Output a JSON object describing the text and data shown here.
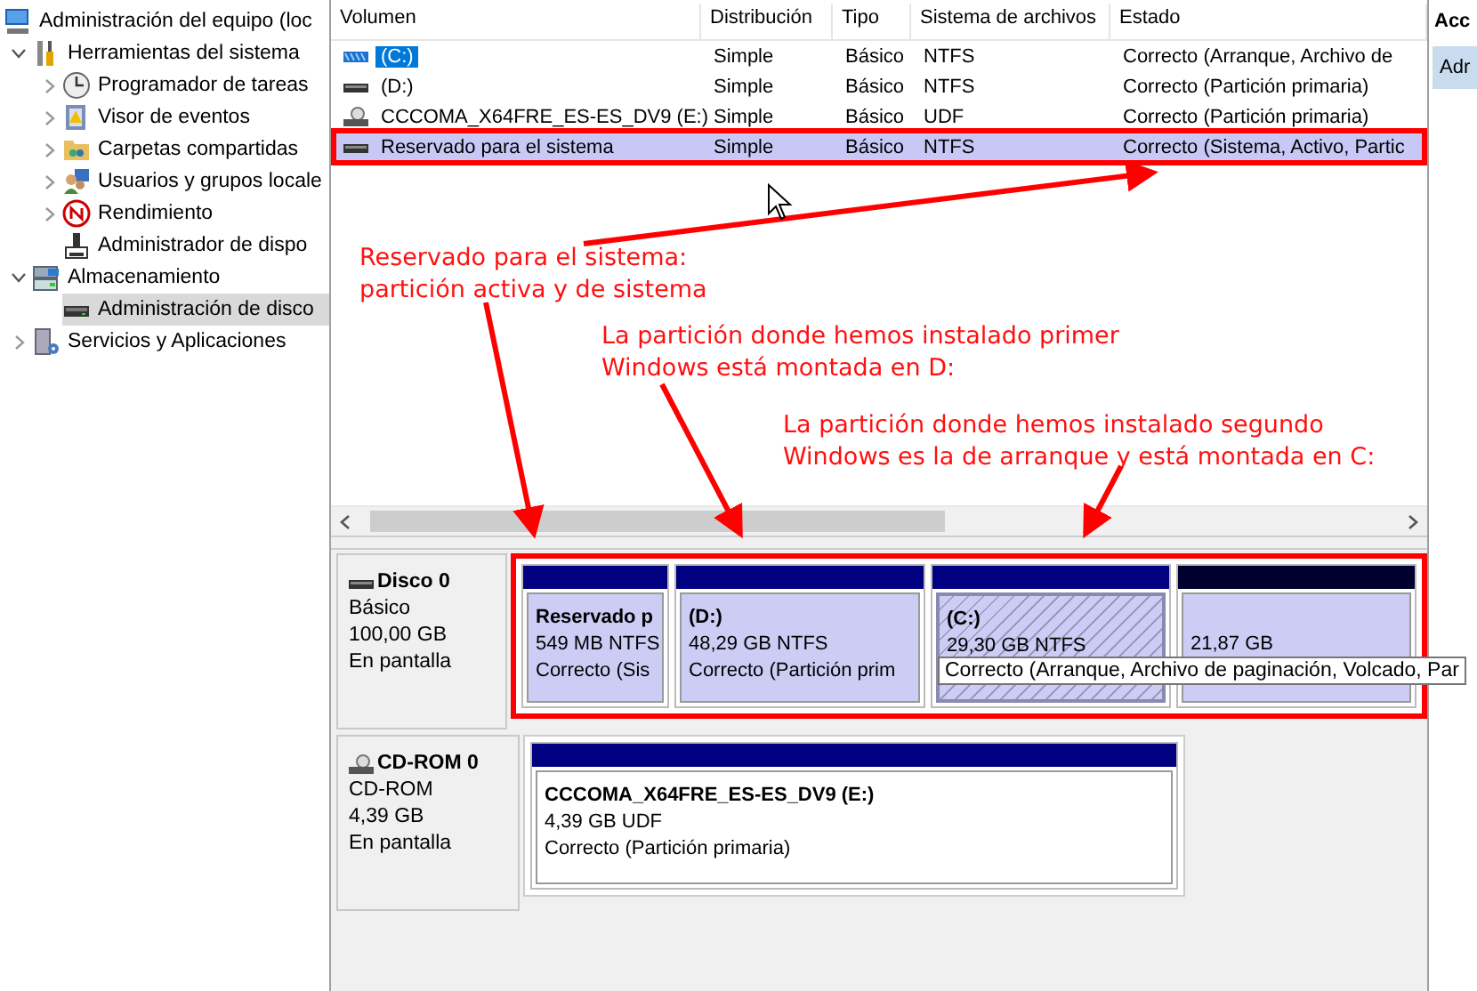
{
  "tree": {
    "items": [
      {
        "label": "Administración del equipo (loc",
        "kind": "computer",
        "selected": false,
        "children": [
          {
            "label": "Herramientas del sistema",
            "kind": "tools",
            "expanded": true,
            "selected": false,
            "children": [
              {
                "label": "Programador de tareas",
                "kind": "clock",
                "expanded": false,
                "selected": false
              },
              {
                "label": "Visor de eventos",
                "kind": "events",
                "expanded": false,
                "selected": false
              },
              {
                "label": "Carpetas compartidas",
                "kind": "shared",
                "expanded": false,
                "selected": false
              },
              {
                "label": "Usuarios y grupos locale",
                "kind": "users",
                "expanded": false,
                "selected": false
              },
              {
                "label": "Rendimiento",
                "kind": "perf",
                "expanded": false,
                "selected": false
              },
              {
                "label": "Administrador de dispo",
                "kind": "device",
                "selected": false
              }
            ]
          },
          {
            "label": "Almacenamiento",
            "kind": "storage",
            "expanded": true,
            "selected": false,
            "children": [
              {
                "label": "Administración de disco",
                "kind": "disk",
                "selected": true
              }
            ]
          },
          {
            "label": "Servicios y Aplicaciones",
            "kind": "services",
            "expanded": false,
            "selected": false
          }
        ]
      }
    ]
  },
  "volume_table": {
    "columns": [
      "Volumen",
      "Distribución",
      "Tipo",
      "Sistema de archivos",
      "Estado"
    ],
    "rows": [
      {
        "kind": "striped",
        "focused": true,
        "selected": false,
        "highlighted": false,
        "cells": [
          "(C:)",
          "Simple",
          "Básico",
          "NTFS",
          "Correcto (Arranque, Archivo de"
        ]
      },
      {
        "kind": "drive",
        "focused": false,
        "selected": false,
        "highlighted": false,
        "cells": [
          "(D:)",
          "Simple",
          "Básico",
          "NTFS",
          "Correcto (Partición primaria)"
        ]
      },
      {
        "kind": "cd",
        "focused": false,
        "selected": false,
        "highlighted": false,
        "cells": [
          "CCCOMA_X64FRE_ES-ES_DV9 (E:)",
          "Simple",
          "Básico",
          "UDF",
          "Correcto (Partición primaria)"
        ]
      },
      {
        "kind": "drive",
        "focused": false,
        "selected": true,
        "highlighted": true,
        "cells": [
          "Reservado para el sistema",
          "Simple",
          "Básico",
          "NTFS",
          "Correcto (Sistema, Activo, Partic"
        ]
      }
    ]
  },
  "disks": [
    {
      "kind": "drive",
      "name": "Disco 0",
      "lines": [
        "Básico",
        "100,00 GB",
        "En pantalla"
      ],
      "selected": true,
      "highlighted": true,
      "partitions": [
        {
          "kind": "primary",
          "title": "Reservado p",
          "lines": [
            "549 MB NTFS",
            "Correcto (Sis"
          ],
          "selected": false
        },
        {
          "kind": "primary",
          "title": "(D:)",
          "lines": [
            "48,29 GB NTFS",
            "Correcto (Partición prim"
          ],
          "selected": false
        },
        {
          "kind": "primary",
          "title": "(C:)",
          "lines": [
            "29,30 GB NTFS"
          ],
          "selected": true
        },
        {
          "kind": "unallocated",
          "lines": [
            "21,87 GB"
          ],
          "selected": false
        }
      ]
    },
    {
      "kind": "cd",
      "name": "CD-ROM 0",
      "lines": [
        "CD-ROM",
        "4,39 GB",
        "En pantalla"
      ],
      "selected": false,
      "highlighted": false,
      "partitions": [
        {
          "kind": "primary",
          "title": "CCCOMA_X64FRE_ES-ES_DV9  (E:)",
          "lines": [
            "4,39 GB UDF",
            "Correcto (Partición primaria)"
          ],
          "selected": false
        }
      ]
    }
  ],
  "tooltip": "Correcto (Arranque, Archivo de paginación, Volcado, Par",
  "actions_panel": {
    "title": "Acc",
    "items": [
      "Adr"
    ]
  },
  "annotations": [
    {
      "lines": [
        "Reservado para el sistema:",
        "partición activa y de sistema"
      ]
    },
    {
      "lines": [
        "La partición donde hemos instalado primer",
        "Windows está montada en D:"
      ]
    },
    {
      "lines": [
        "La partición donde hemos instalado segundo",
        "Windows es la de arranque y está montada en C:"
      ]
    }
  ]
}
